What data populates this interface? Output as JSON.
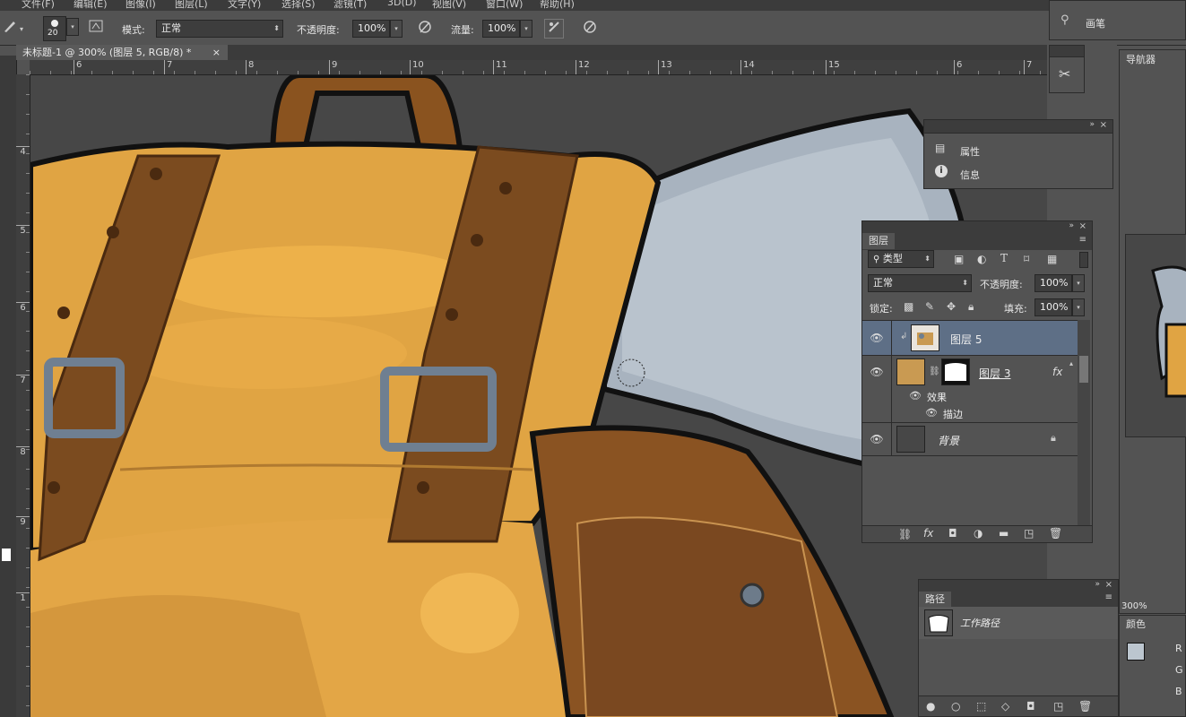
{
  "menu": [
    "文件(F)",
    "编辑(E)",
    "图像(I)",
    "图层(L)",
    "文字(Y)",
    "选择(S)",
    "滤镜(T)",
    "3D(D)",
    "视图(V)",
    "窗口(W)",
    "帮助(H)"
  ],
  "options_bar": {
    "brush_size": "20",
    "mode_label": "模式:",
    "mode_value": "正常",
    "opacity_label": "不透明度:",
    "opacity_value": "100%",
    "flow_label": "流量:",
    "flow_value": "100%"
  },
  "document_tab": {
    "title": "未标题-1 @ 300% (图层 5, RGB/8) *",
    "close": "×"
  },
  "ruler": {
    "horizontal_ticks": [
      "6",
      "7",
      "8",
      "9",
      "10",
      "11",
      "12",
      "13",
      "14",
      "15",
      "6",
      "7"
    ],
    "vertical_ticks": [
      "4",
      "5",
      "6",
      "7",
      "8",
      "9",
      "1"
    ]
  },
  "brush_panel": {
    "label": "画笔"
  },
  "navigator_panel": {
    "tab": "导航器",
    "zoom": "300%"
  },
  "properties_panel": {
    "items": [
      {
        "icon": "properties-icon",
        "label": "属性"
      },
      {
        "icon": "info-icon",
        "label": "信息"
      }
    ]
  },
  "layers_panel": {
    "tab": "图层",
    "filter_kind": "类型",
    "blend_mode": "正常",
    "opacity_label": "不透明度:",
    "opacity_value": "100%",
    "lock_label": "锁定:",
    "fill_label": "填充:",
    "fill_value": "100%",
    "layers": [
      {
        "name": "图层 5",
        "selected": true
      },
      {
        "name": "图层 3",
        "selected": false,
        "fx": "fx"
      },
      {
        "name": "背景",
        "selected": false
      }
    ],
    "effects_label": "效果",
    "stroke_label": "描边"
  },
  "paths_panel": {
    "tab": "路径",
    "item": "工作路径"
  },
  "color_panel": {
    "tab": "颜色",
    "channels": [
      "R",
      "G",
      "B"
    ]
  },
  "colors": {
    "panel_bg": "#535353",
    "selected_layer": "#5e6f86",
    "bag_yellow": "#e8a845",
    "strap_brown": "#7a4a1e",
    "metal": "#8f9aa6"
  }
}
